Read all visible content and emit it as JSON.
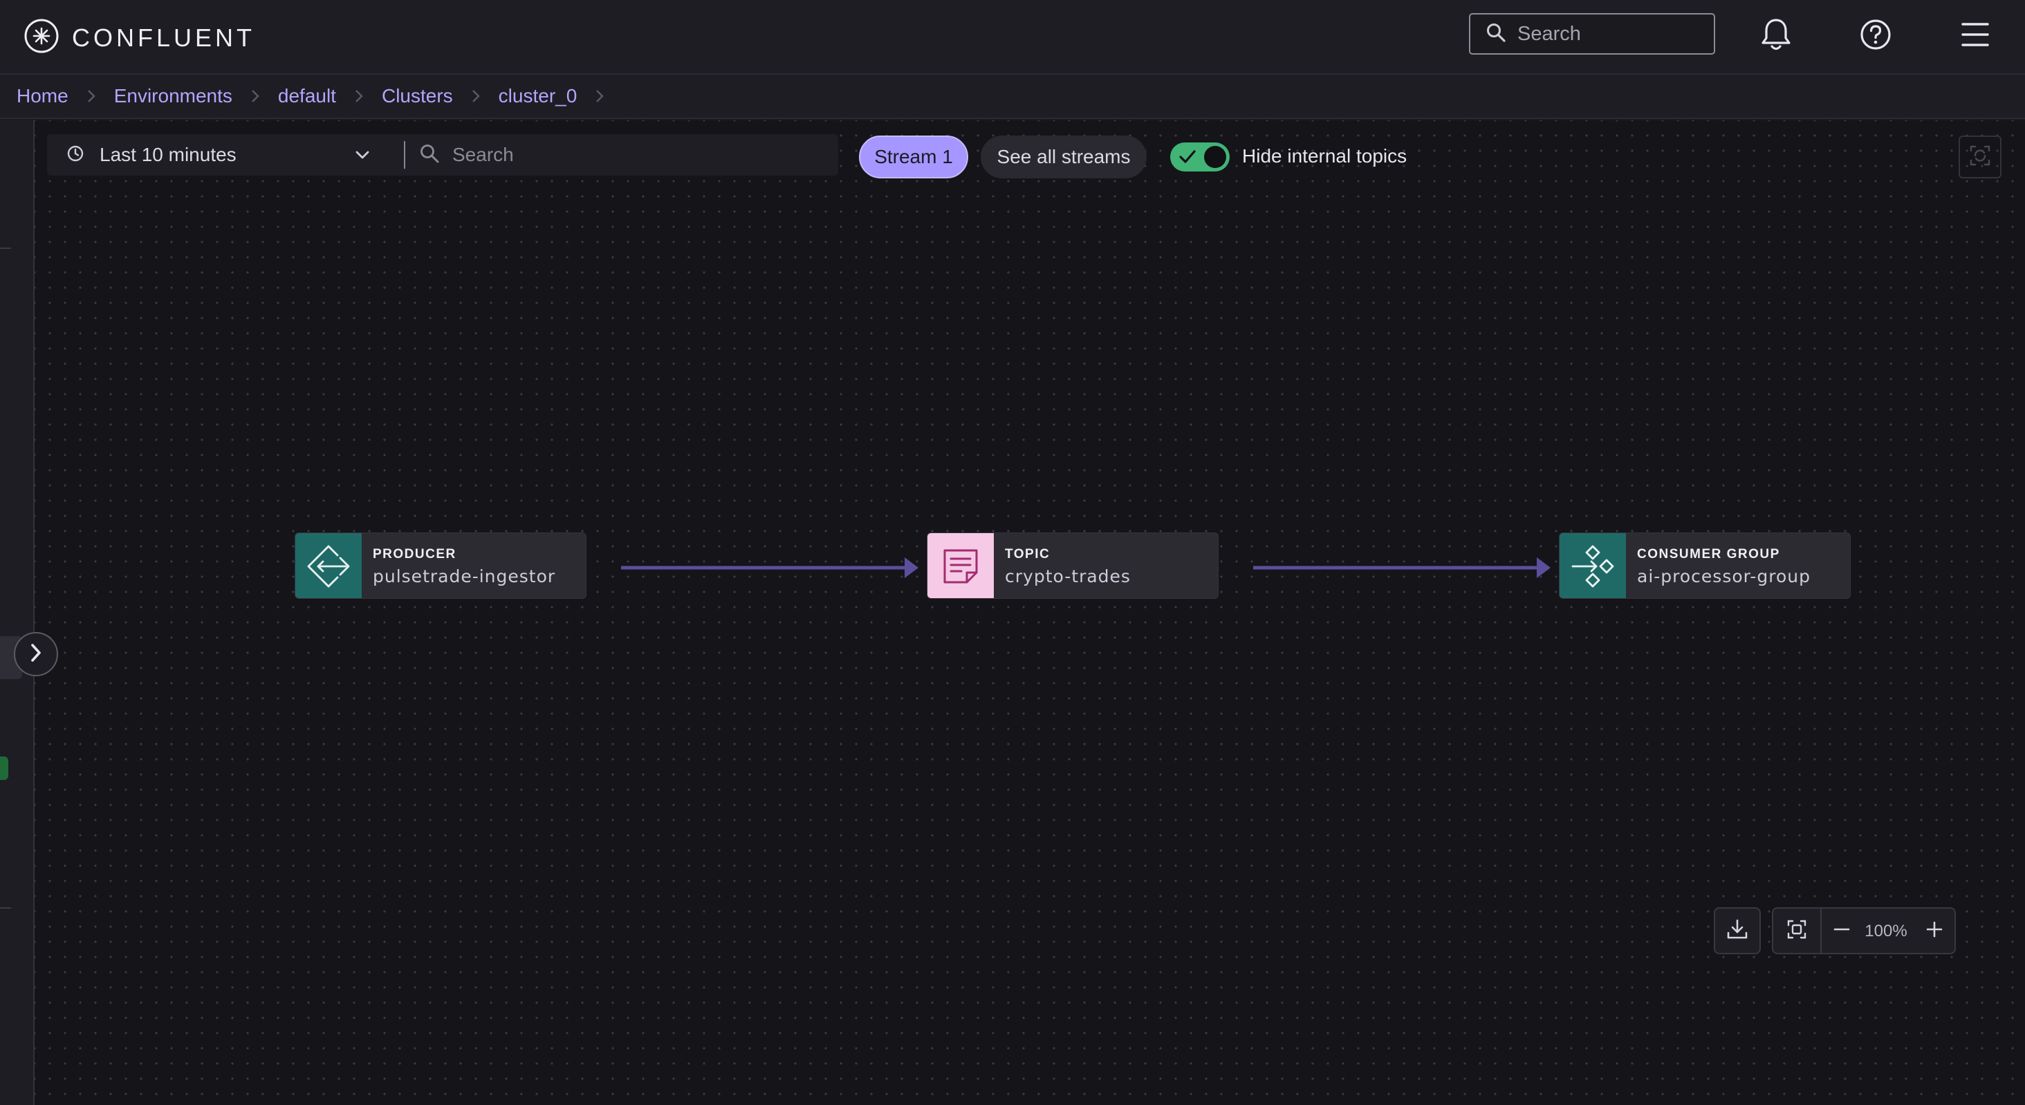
{
  "header": {
    "brand": "CONFLUENT",
    "search_placeholder": "Search",
    "icons": [
      "confluent-logo-icon",
      "search-icon",
      "bell-icon",
      "help-icon",
      "menu-icon"
    ]
  },
  "breadcrumb": {
    "items": [
      "Home",
      "Environments",
      "default",
      "Clusters",
      "cluster_0"
    ]
  },
  "toolbar": {
    "time_range": "Last 10 minutes",
    "search_placeholder": "Search",
    "stream_chip": "Stream 1",
    "see_all_label": "See all streams",
    "hide_internal_label": "Hide internal topics",
    "hide_internal_enabled": true
  },
  "graph": {
    "nodes": [
      {
        "type": "PRODUCER",
        "name": "pulsetrade-ingestor",
        "icon": "producer-icon",
        "color": "#1f6a67"
      },
      {
        "type": "TOPIC",
        "name": "crypto-trades",
        "icon": "topic-icon",
        "color": "#f6c9e6"
      },
      {
        "type": "CONSUMER GROUP",
        "name": "ai-processor-group",
        "icon": "consumer-group-icon",
        "color": "#1f6a67"
      }
    ],
    "edge_color": "#5b4f9c"
  },
  "controls": {
    "zoom_level": "100%"
  },
  "colors": {
    "accent": "#a597ff",
    "link": "#b6a4ff",
    "toggle_on": "#41b476",
    "background": "#151419"
  }
}
